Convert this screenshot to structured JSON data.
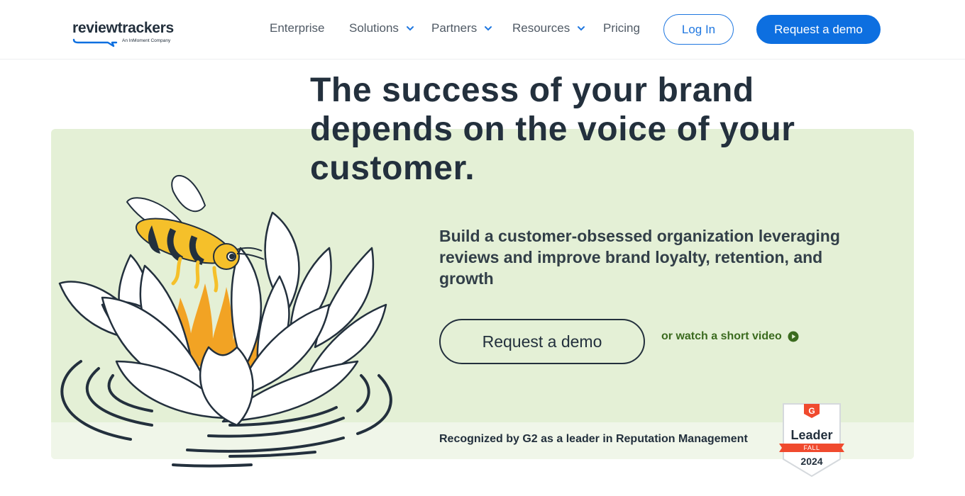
{
  "header": {
    "logo": {
      "wordmark": "reviewtrackers",
      "tagline": "An InMoment Company"
    },
    "nav": [
      {
        "label": "Enterprise",
        "has_dropdown": false
      },
      {
        "label": "Solutions",
        "has_dropdown": true
      },
      {
        "label": "Partners",
        "has_dropdown": true
      },
      {
        "label": "Resources",
        "has_dropdown": true
      },
      {
        "label": "Pricing",
        "has_dropdown": false
      }
    ],
    "login_label": "Log In",
    "demo_label": "Request a demo"
  },
  "hero": {
    "headline": "The success of your brand depends on the voice of your customer.",
    "subtext": "Build a customer-obsessed organization leveraging reviews and improve brand loyalty, retention, and growth",
    "cta_label": "Request a demo",
    "video_link_label": "or watch a short video",
    "recognition_text": "Recognized by G2 as a leader in Reputation Management",
    "badge": {
      "logo": "G",
      "title": "Leader",
      "season": "FALL",
      "year": "2024"
    }
  },
  "colors": {
    "primary_blue": "#0d6fe0",
    "hero_green": "#e4f0d6",
    "text_dark": "#23303d",
    "link_green": "#3b6b1f",
    "badge_red": "#f04a2e",
    "bee_yellow": "#f5c02a",
    "flame_orange": "#f2a324"
  },
  "icons": {
    "chevron": "chevron-down-icon",
    "play": "play-circle-icon",
    "illustration": "bee-on-lotus-illustration"
  }
}
